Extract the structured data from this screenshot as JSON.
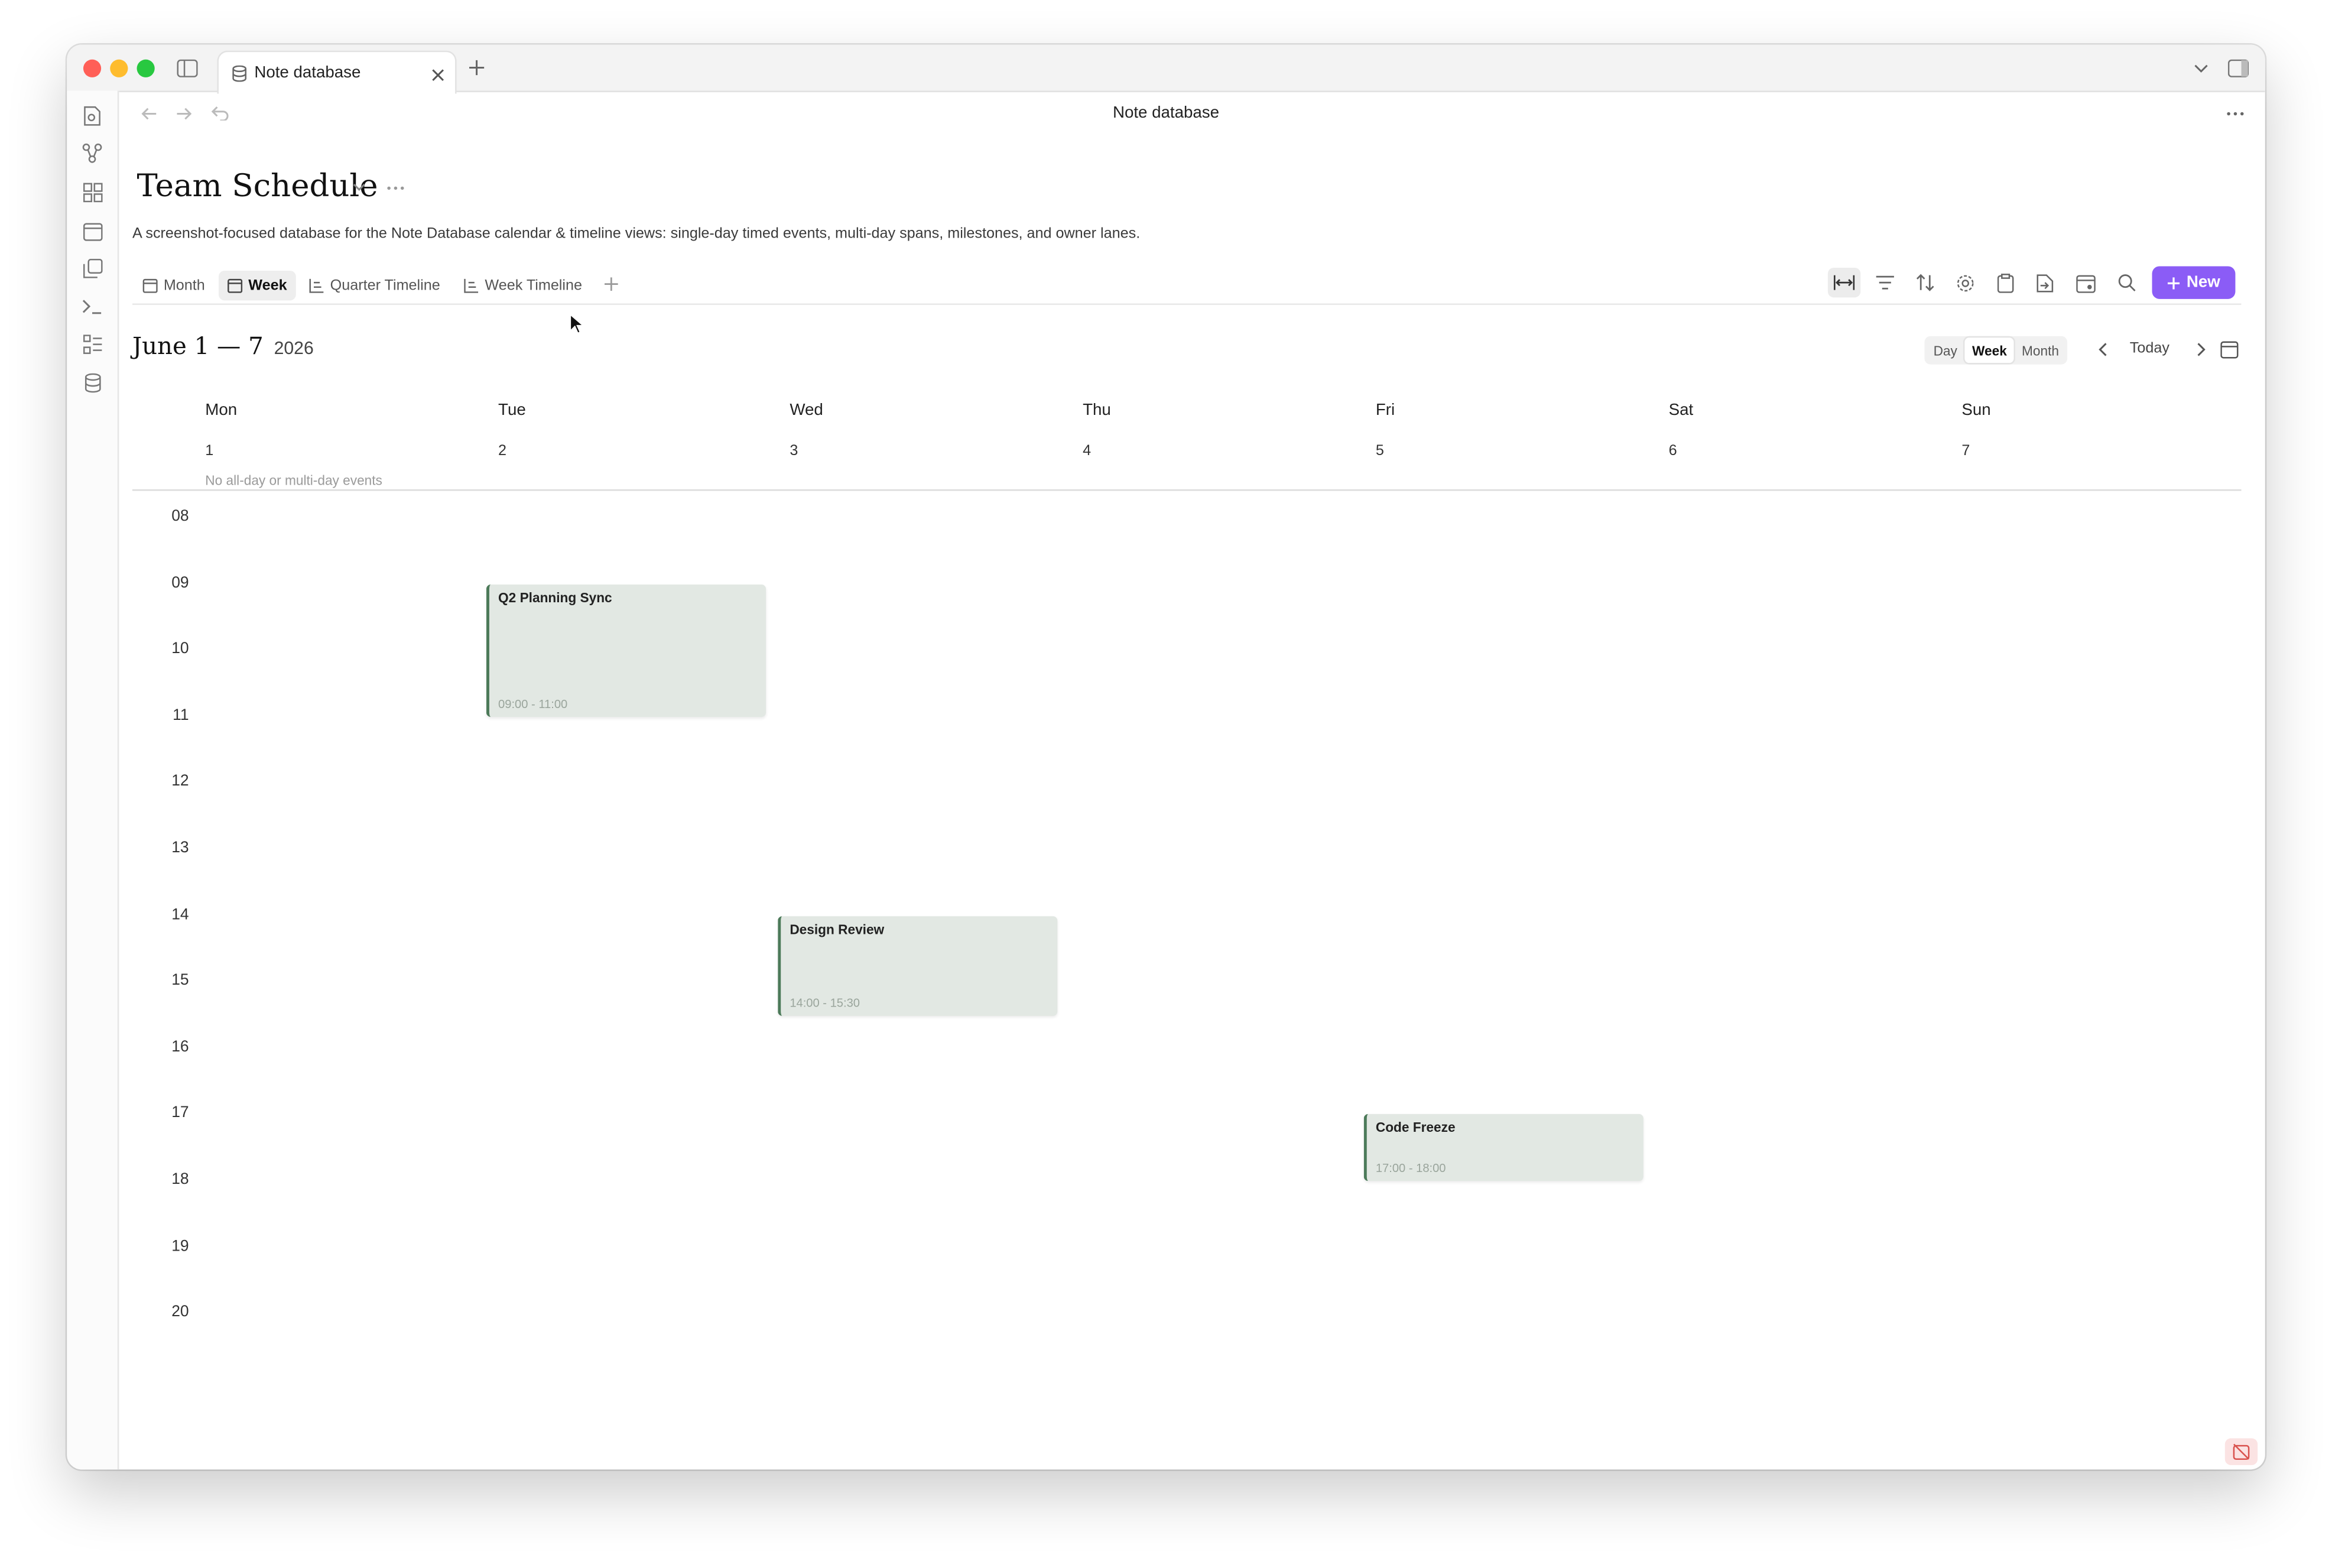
{
  "window": {
    "tab_title": "Note database",
    "nav_title": "Note database"
  },
  "page": {
    "title": "Team Schedule",
    "description": "A screenshot-focused database for the Note Database calendar & timeline views: single-day timed events, multi-day spans, milestones, and owner lanes."
  },
  "views": [
    {
      "label": "Month",
      "icon": "calendar-icon",
      "active": false
    },
    {
      "label": "Week",
      "icon": "calendar-icon",
      "active": true
    },
    {
      "label": "Quarter Timeline",
      "icon": "timeline-icon",
      "active": false
    },
    {
      "label": "Week Timeline",
      "icon": "timeline-icon",
      "active": false
    }
  ],
  "toolbar": {
    "new_label": "New",
    "accent": "#8b5cf6"
  },
  "calendar": {
    "range_label": "June 1 — 7",
    "year": "2026",
    "modes": [
      "Day",
      "Week",
      "Month"
    ],
    "active_mode": "Week",
    "today_label": "Today",
    "days": [
      {
        "name": "Mon",
        "num": "1"
      },
      {
        "name": "Tue",
        "num": "2"
      },
      {
        "name": "Wed",
        "num": "3"
      },
      {
        "name": "Thu",
        "num": "4"
      },
      {
        "name": "Fri",
        "num": "5"
      },
      {
        "name": "Sat",
        "num": "6"
      },
      {
        "name": "Sun",
        "num": "7"
      }
    ],
    "all_day_empty": "No all-day or multi-day events",
    "hours": [
      "08",
      "09",
      "10",
      "11",
      "12",
      "13",
      "14",
      "15",
      "16",
      "17",
      "18",
      "19",
      "20"
    ],
    "events": [
      {
        "title": "Q2 Planning Sync",
        "time": "09:00 - 11:00",
        "day": "Tue"
      },
      {
        "title": "Design Review",
        "time": "14:00 - 15:30",
        "day": "Wed"
      },
      {
        "title": "Code Freeze",
        "time": "17:00 - 18:00",
        "day": "Fri"
      }
    ],
    "event_color": "#4c7a59"
  }
}
